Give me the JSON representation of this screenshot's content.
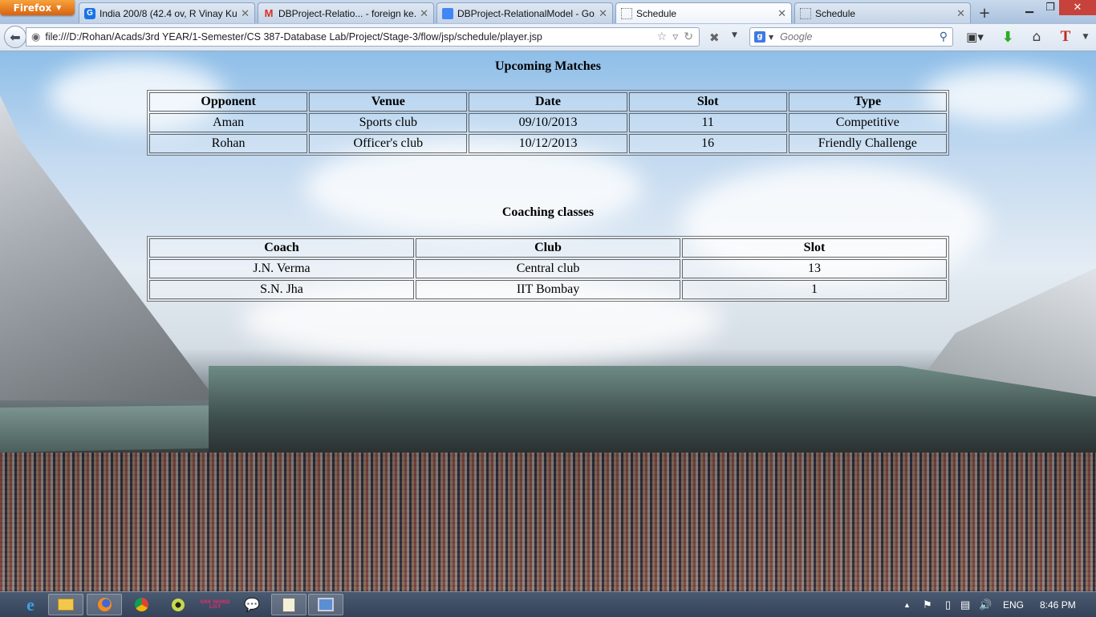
{
  "browser": {
    "app_button": "Firefox",
    "tabs": [
      {
        "title": "India 200/8 (42.4 ov, R Vinay Ku...",
        "icon": "google-icon",
        "active": false
      },
      {
        "title": "DBProject-Relatio... - foreign ke...",
        "icon": "gmail-icon",
        "active": false
      },
      {
        "title": "DBProject-RelationalModel - Go...",
        "icon": "docs-icon",
        "active": false
      },
      {
        "title": "Schedule",
        "icon": "blank-page-icon",
        "active": true
      },
      {
        "title": "Schedule",
        "icon": "blank-page-icon",
        "active": false
      }
    ],
    "url": "file:///D:/Rohan/Acads/3rd YEAR/1-Semester/CS 387-Database Lab/Project/Stage-3/flow/jsp/schedule/player.jsp",
    "search_placeholder": "Google"
  },
  "page": {
    "matches_title": "Upcoming Matches",
    "matches_headers": [
      "Opponent",
      "Venue",
      "Date",
      "Slot",
      "Type"
    ],
    "matches_rows": [
      [
        "Aman",
        "Sports club",
        "09/10/2013",
        "11",
        "Competitive"
      ],
      [
        "Rohan",
        "Officer's club",
        "10/12/2013",
        "16",
        "Friendly Challenge"
      ]
    ],
    "coaching_title": "Coaching classes",
    "coaching_headers": [
      "Coach",
      "Club",
      "Slot"
    ],
    "coaching_rows": [
      [
        "J.N. Verma",
        "Central club",
        "13"
      ],
      [
        "S.N. Jha",
        "IIT Bombay",
        "1"
      ]
    ]
  },
  "taskbar": {
    "language": "ENG",
    "time": "8:46 PM",
    "gre_label": "GRE WORD LIST"
  }
}
